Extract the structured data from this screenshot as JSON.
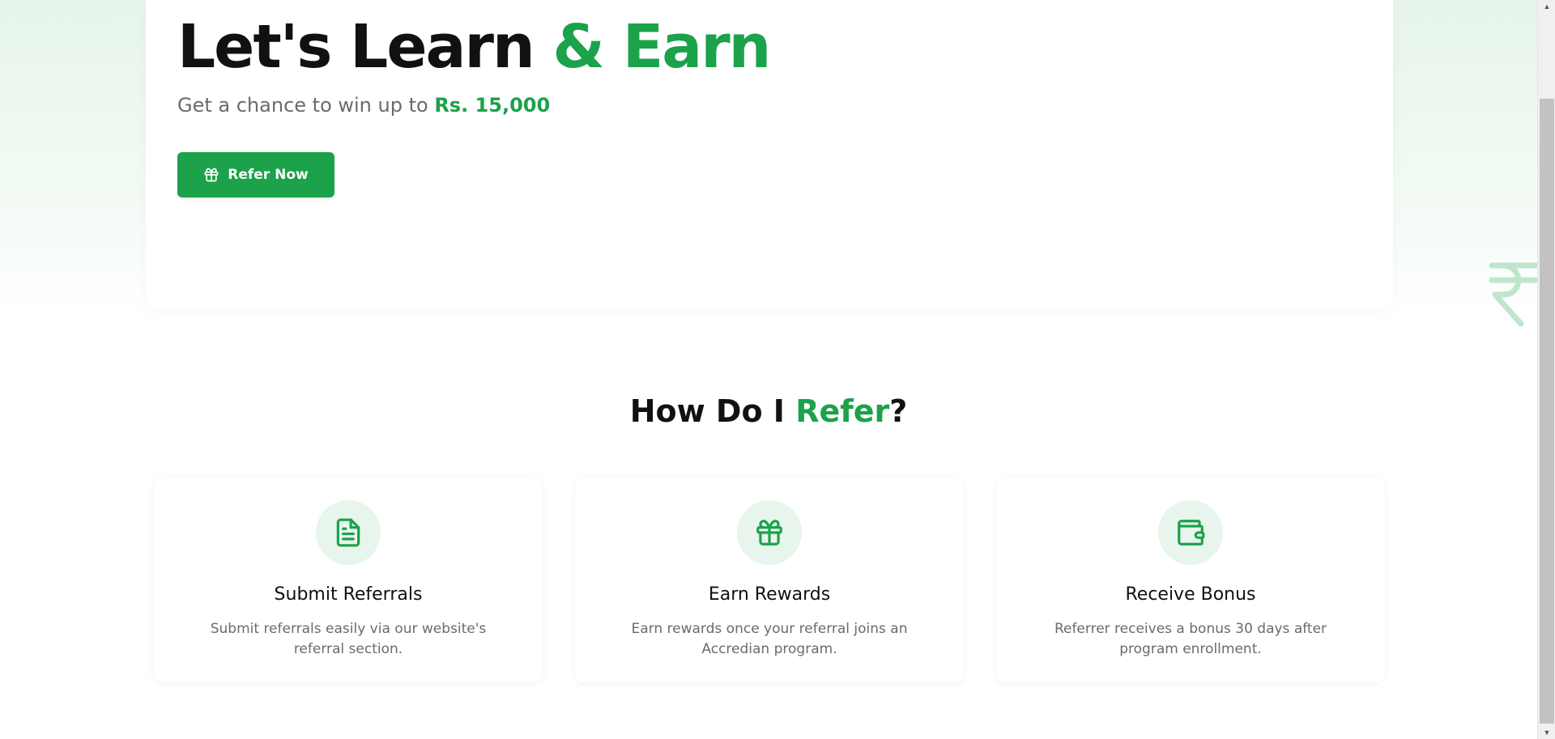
{
  "hero": {
    "title_main": "Let's Learn ",
    "title_accent": "& Earn",
    "subtitle_prefix": "Get a chance to win up to ",
    "subtitle_amount": "Rs. 15,000",
    "button_label": "Refer Now",
    "button_icon": "gift-icon",
    "decoration_icon": "rupee-icon"
  },
  "how_section": {
    "title_prefix": "How Do I ",
    "title_accent": "Refer",
    "title_suffix": "?",
    "cards": [
      {
        "icon": "document-icon",
        "title": "Submit Referrals",
        "description": "Submit referrals easily via our website's referral section."
      },
      {
        "icon": "gift-icon",
        "title": "Earn Rewards",
        "description": "Earn rewards once your referral joins an Accredian program."
      },
      {
        "icon": "wallet-icon",
        "title": "Receive Bonus",
        "description": "Referrer receives a bonus 30 days after program enrollment."
      }
    ]
  },
  "colors": {
    "accent": "#1ba24a",
    "icon_bg": "#e8f5ec",
    "text_dark": "#111111",
    "text_muted": "#6b6b6b"
  }
}
